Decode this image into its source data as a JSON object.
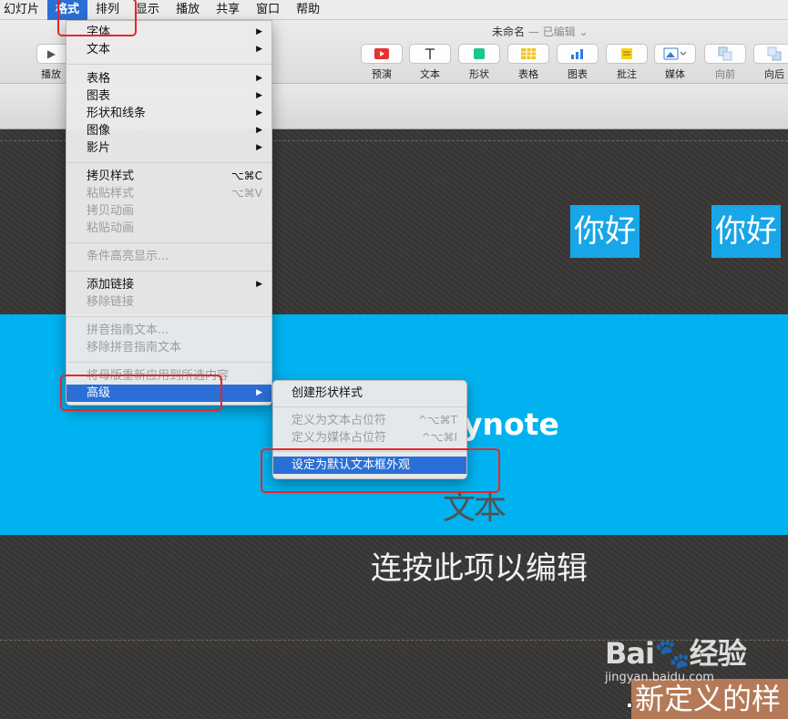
{
  "menubar": {
    "items": [
      "幻灯片",
      "格式",
      "排列",
      "显示",
      "播放",
      "共享",
      "窗口",
      "帮助"
    ]
  },
  "toolbar": {
    "doc_title": "未命名",
    "doc_status": "— 已编辑 ⌄",
    "left_label": "播放",
    "buttons": [
      {
        "label": "预演",
        "icon": "play-icon"
      },
      {
        "label": "文本",
        "icon": "text-icon"
      },
      {
        "label": "形状",
        "icon": "shape-icon"
      },
      {
        "label": "表格",
        "icon": "table-icon"
      },
      {
        "label": "图表",
        "icon": "chart-icon"
      },
      {
        "label": "批注",
        "icon": "comment-icon"
      },
      {
        "label": "媒体",
        "icon": "media-icon"
      },
      {
        "label": "向前",
        "icon": "bring-forward-icon"
      },
      {
        "label": "向后",
        "icon": "send-backward-icon"
      }
    ]
  },
  "format_menu": {
    "items": [
      {
        "label": "字体",
        "submenu": true
      },
      {
        "label": "文本",
        "submenu": true
      },
      {
        "label": "表格",
        "submenu": true
      },
      {
        "label": "图表",
        "submenu": true
      },
      {
        "label": "形状和线条",
        "submenu": true
      },
      {
        "label": "图像",
        "submenu": true
      },
      {
        "label": "影片",
        "submenu": true
      },
      {
        "label": "拷贝样式",
        "shortcut": "⌥⌘C"
      },
      {
        "label": "粘贴样式",
        "shortcut": "⌥⌘V"
      },
      {
        "label": "拷贝动画"
      },
      {
        "label": "粘贴动画"
      },
      {
        "label": "条件高亮显示..."
      },
      {
        "label": "添加链接",
        "submenu": true
      },
      {
        "label": "移除链接"
      },
      {
        "label": "拼音指南文本..."
      },
      {
        "label": "移除拼音指南文本"
      },
      {
        "label": "将母版重新应用到所选内容"
      },
      {
        "label": "高级",
        "submenu": true
      }
    ]
  },
  "advanced_submenu": {
    "items": [
      {
        "label": "创建形状样式"
      },
      {
        "label": "定义为文本占位符",
        "shortcut": "^⌥⌘T"
      },
      {
        "label": "定义为媒体占位符",
        "shortcut": "^⌥⌘I"
      },
      {
        "label": "设定为默认文本框外观"
      }
    ]
  },
  "slide": {
    "hello_1": "你好",
    "hello_2": "你好",
    "keynote_fragment": "ynote",
    "ghost_text": "文本",
    "edit_hint": "连按此项以编辑",
    "corner_text": "新定义的样"
  },
  "watermark": {
    "logo": "Bai🐾经验",
    "url": "jingyan.baidu.com"
  },
  "colors": {
    "menu_highlight": "#2b6fd6",
    "slide_band": "#00b3f0",
    "callout": "#e8252a"
  }
}
